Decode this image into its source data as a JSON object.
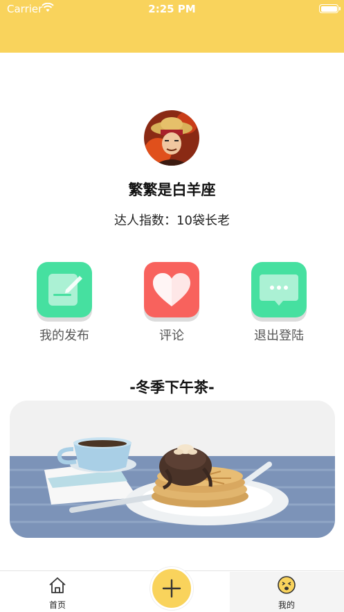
{
  "status_bar": {
    "carrier": "Carrier",
    "time": "2:25 PM"
  },
  "profile": {
    "name": "繁繁是白羊座",
    "score_text": "达人指数：10袋长老"
  },
  "actions": [
    {
      "label": "我的发布",
      "icon": "note-edit-icon",
      "color": "#46E0A0"
    },
    {
      "label": "评论",
      "icon": "heart-icon",
      "color": "#F8625D"
    },
    {
      "label": "退出登陆",
      "icon": "chat-bubble-icon",
      "color": "#46E0A0"
    }
  ],
  "section": {
    "title": "-冬季下午茶-"
  },
  "tabbar": {
    "home_label": "首页",
    "mine_label": "我的",
    "add_icon": "plus-icon"
  },
  "colors": {
    "accent": "#F9D35C",
    "green": "#46E0A0",
    "red": "#F8625D"
  }
}
